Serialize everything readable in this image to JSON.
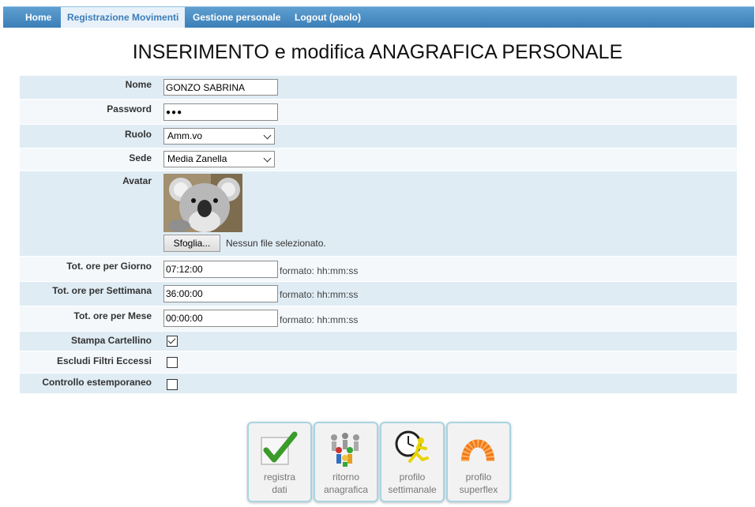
{
  "nav": {
    "items": [
      {
        "label": "Home",
        "active": false
      },
      {
        "label": "Registrazione Movimenti",
        "active": true
      },
      {
        "label": "Gestione personale",
        "active": false
      },
      {
        "label": "Logout (paolo)",
        "active": false
      }
    ]
  },
  "title": "INSERIMENTO e modifica ANAGRAFICA PERSONALE",
  "form": {
    "nome": {
      "label": "Nome",
      "value": "GONZO  SABRINA"
    },
    "password": {
      "label": "Password",
      "value": "●●●"
    },
    "ruolo": {
      "label": "Ruolo",
      "selected": "Amm.vo"
    },
    "sede": {
      "label": "Sede",
      "selected": "Media Zanella"
    },
    "avatar": {
      "label": "Avatar",
      "browse_label": "Sfoglia...",
      "file_status": "Nessun file selezionato."
    },
    "ore_giorno": {
      "label": "Tot. ore per Giorno",
      "value": "07:12:00",
      "hint": "formato: hh:mm:ss"
    },
    "ore_settimana": {
      "label": "Tot. ore per Settimana",
      "value": "36:00:00",
      "hint": "formato: hh:mm:ss"
    },
    "ore_mese": {
      "label": "Tot. ore per Mese",
      "value": "00:00:00",
      "hint": "formato: hh:mm:ss"
    },
    "stampa_cartellino": {
      "label": "Stampa Cartellino",
      "checked": true
    },
    "escludi_filtri": {
      "label": "Escludi Filtri Eccessi",
      "checked": false
    },
    "controllo": {
      "label": "Controllo estemporaneo",
      "checked": false
    }
  },
  "actions": [
    {
      "line1": "registra",
      "line2": "dati",
      "icon": "checkmark-icon"
    },
    {
      "line1": "ritorno",
      "line2": "anagrafica",
      "icon": "people-icon"
    },
    {
      "line1": "profilo",
      "line2": "settimanale",
      "icon": "clock-runner-icon"
    },
    {
      "line1": "profilo",
      "line2": "superflex",
      "icon": "spring-icon"
    }
  ],
  "colors": {
    "nav_bar": "#3b7fb8",
    "row_shaded": "#dfecf4",
    "row_plain": "#f4f8fb",
    "card_border": "#a8d4e3"
  }
}
